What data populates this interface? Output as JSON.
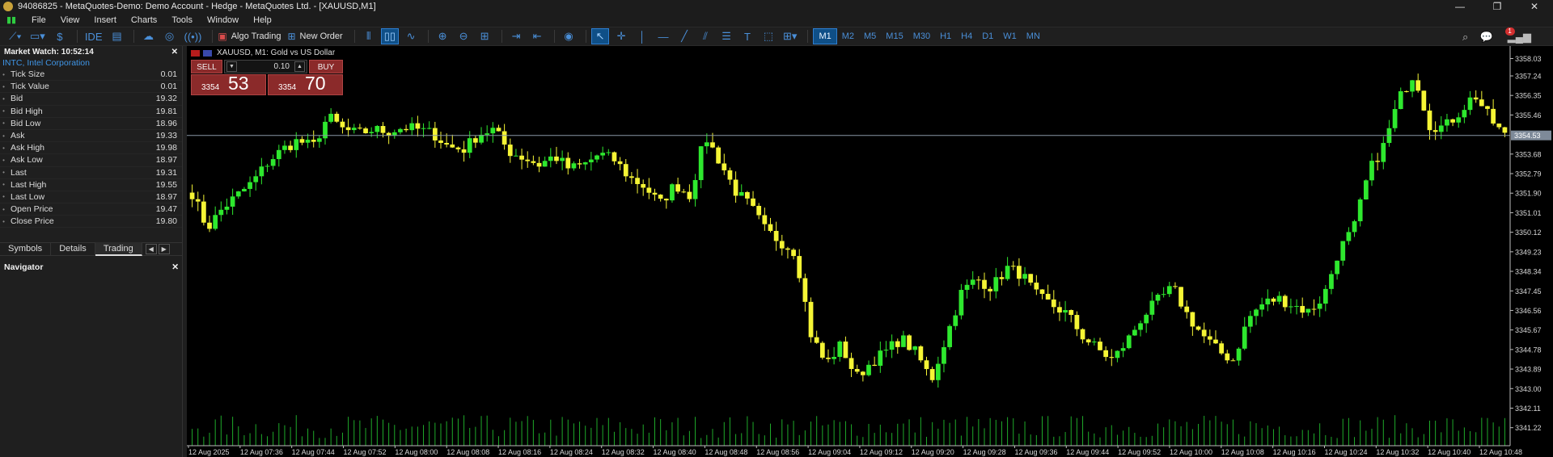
{
  "window": {
    "title": "94086825 - MetaQuotes-Demo: Demo Account - Hedge - MetaQuotes Ltd. - [XAUUSD,M1]",
    "controls": [
      "—",
      "❐",
      "✕"
    ]
  },
  "menu": [
    "File",
    "View",
    "Insert",
    "Charts",
    "Tools",
    "Window",
    "Help"
  ],
  "toolbar": {
    "ide": "IDE",
    "algo_trading": "Algo Trading",
    "new_order": "New Order",
    "timeframes": [
      "M1",
      "M2",
      "M5",
      "M15",
      "M30",
      "H1",
      "H4",
      "D1",
      "W1",
      "MN"
    ],
    "active_timeframe": "M1",
    "notification_count": "1"
  },
  "market_watch": {
    "title": "Market Watch: 10:52:14",
    "symbol": "INTC, Intel Corporation",
    "rows": [
      {
        "label": "Tick Size",
        "value": "0.01"
      },
      {
        "label": "Tick Value",
        "value": "0.01"
      },
      {
        "label": "Bid",
        "value": "19.32"
      },
      {
        "label": "Bid High",
        "value": "19.81"
      },
      {
        "label": "Bid Low",
        "value": "18.96"
      },
      {
        "label": "Ask",
        "value": "19.33"
      },
      {
        "label": "Ask High",
        "value": "19.98"
      },
      {
        "label": "Ask Low",
        "value": "18.97"
      },
      {
        "label": "Last",
        "value": "19.31"
      },
      {
        "label": "Last High",
        "value": "19.55"
      },
      {
        "label": "Last Low",
        "value": "18.97"
      },
      {
        "label": "Open Price",
        "value": "19.47"
      },
      {
        "label": "Close Price",
        "value": "19.80"
      }
    ],
    "tabs": [
      "Symbols",
      "Details",
      "Trading"
    ],
    "active_tab": "Trading"
  },
  "navigator": {
    "title": "Navigator"
  },
  "chart": {
    "label": "XAUUSD, M1:  Gold vs US Dollar",
    "sell_label": "SELL",
    "buy_label": "BUY",
    "volume": "0.10",
    "sell_price_small": "3354",
    "sell_price_big": "53",
    "buy_price_small": "3354",
    "buy_price_big": "70",
    "current_price_label": "3354.53"
  },
  "chart_data": {
    "type": "candlestick",
    "symbol": "XAUUSD",
    "timeframe": "M1",
    "current_price": 3354.53,
    "ylim": [
      3340.4,
      3358.6
    ],
    "y_ticks": [
      "3358.03",
      "3357.24",
      "3356.35",
      "3355.46",
      "3353.68",
      "3352.79",
      "3351.90",
      "3351.01",
      "3350.12",
      "3349.23",
      "3348.34",
      "3347.45",
      "3346.56",
      "3345.67",
      "3344.78",
      "3343.89",
      "3343.00",
      "3342.11",
      "3341.22"
    ],
    "x_ticks": [
      "12 Aug 2025",
      "12 Aug 07:36",
      "12 Aug 07:44",
      "12 Aug 07:52",
      "12 Aug 08:00",
      "12 Aug 08:08",
      "12 Aug 08:16",
      "12 Aug 08:24",
      "12 Aug 08:32",
      "12 Aug 08:40",
      "12 Aug 08:48",
      "12 Aug 08:56",
      "12 Aug 09:04",
      "12 Aug 09:12",
      "12 Aug 09:20",
      "12 Aug 09:28",
      "12 Aug 09:36",
      "12 Aug 09:44",
      "12 Aug 09:52",
      "12 Aug 10:00",
      "12 Aug 10:08",
      "12 Aug 10:16",
      "12 Aug 10:24",
      "12 Aug 10:32",
      "12 Aug 10:40",
      "12 Aug 10:48"
    ],
    "close_path": [
      3351.9,
      3350.3,
      3351.2,
      3351.8,
      3352.4,
      3353.3,
      3353.9,
      3354.3,
      3354.0,
      3355.4,
      3354.8,
      3354.6,
      3354.8,
      3354.7,
      3354.9,
      3354.8,
      3354.6,
      3354.0,
      3353.9,
      3354.6,
      3354.8,
      3353.8,
      3353.5,
      3353.2,
      3353.6,
      3353.0,
      3353.2,
      3353.7,
      3353.4,
      3352.6,
      3352.2,
      3351.4,
      3352.3,
      3351.8,
      3354.5,
      3353.3,
      3352.0,
      3351.3,
      3350.2,
      3349.7,
      3349.2,
      3345.5,
      3344.1,
      3345.0,
      3343.5,
      3344.2,
      3344.7,
      3345.3,
      3344.6,
      3343.4,
      3345.4,
      3347.4,
      3348.0,
      3347.6,
      3348.5,
      3348.2,
      3347.2,
      3346.8,
      3346.4,
      3345.4,
      3344.8,
      3344.3,
      3345.2,
      3346.3,
      3347.0,
      3347.6,
      3346.3,
      3345.4,
      3344.7,
      3344.3,
      3346.2,
      3346.9,
      3347.1,
      3346.8,
      3346.5,
      3347.2,
      3349.3,
      3350.3,
      3352.9,
      3354.1,
      3356.2,
      3357.4,
      3355.0,
      3354.9,
      3355.6,
      3356.4,
      3355.3,
      3354.5
    ],
    "volume_range": [
      0.25,
      1.0
    ]
  }
}
